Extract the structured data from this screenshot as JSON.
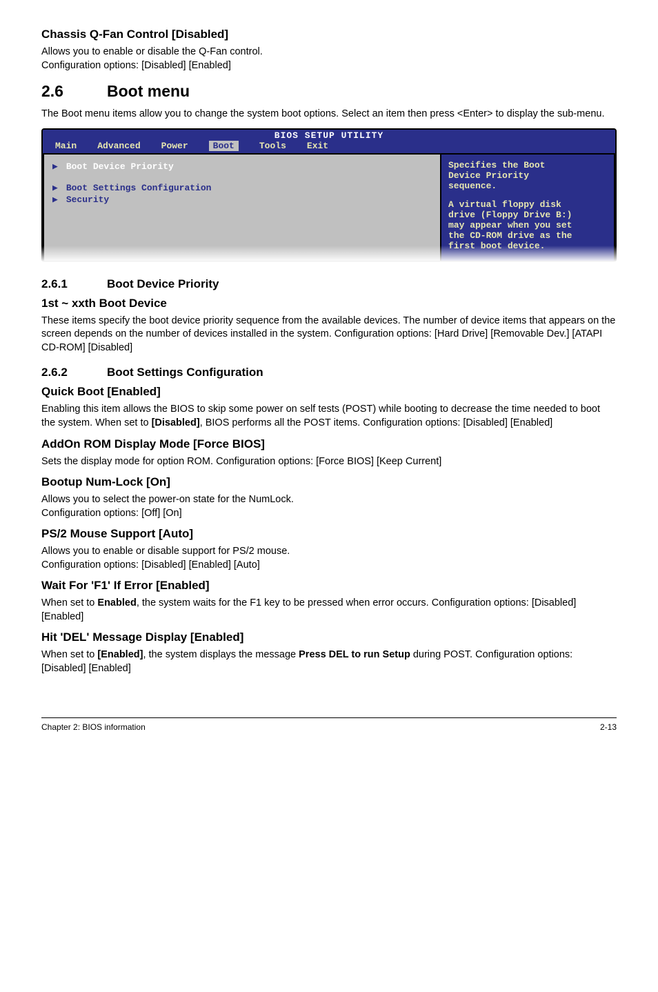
{
  "section_qfan": {
    "heading": "Chassis Q-Fan Control [Disabled]",
    "p1": "Allows you to enable or disable the Q-Fan control.",
    "p2": "Configuration options: [Disabled] [Enabled]"
  },
  "section_2_6": {
    "num": "2.6",
    "title": "Boot menu",
    "p": "The Boot menu items allow you to change the system boot options. Select an item then press <Enter> to display the sub-menu."
  },
  "bios": {
    "title": "BIOS SETUP UTILITY",
    "tabs": {
      "main": "Main",
      "advanced": "Advanced",
      "power": "Power",
      "boot": "Boot",
      "tools": "Tools",
      "exit": "Exit"
    },
    "menu": {
      "boot_device_priority": "Boot Device Priority",
      "boot_settings_config": "Boot Settings Configuration",
      "security": "Security"
    },
    "help": {
      "l1": "Specifies the Boot",
      "l2": "Device Priority",
      "l3": "sequence.",
      "l4": "A virtual floppy disk",
      "l5": "drive (Floppy Drive B:)",
      "l6": "may appear when you set",
      "l7": "the CD-ROM drive as the",
      "l8": "first boot device."
    }
  },
  "section_2_6_1": {
    "num": "2.6.1",
    "title": "Boot Device Priority",
    "sub": "1st ~ xxth Boot Device",
    "p": "These items specify the boot device priority sequence from the available devices. The number of device items that appears on the screen depends on the number of devices installed in the system. Configuration options: [Hard Drive] [Removable Dev.] [ATAPI CD-ROM] [Disabled]"
  },
  "section_2_6_2": {
    "num": "2.6.2",
    "title": "Boot Settings Configuration"
  },
  "quick_boot": {
    "heading": "Quick Boot [Enabled]",
    "p1": "Enabling this item allows the BIOS to skip some power on self tests (POST) while booting to decrease the time needed to boot the system. When set to ",
    "bold": "[Disabled]",
    "p1b": ", BIOS performs all the POST items. Configuration options: [Disabled] [Enabled]"
  },
  "addon_rom": {
    "heading": "AddOn ROM Display Mode [Force BIOS]",
    "p": "Sets the display mode for option ROM. Configuration options: [Force BIOS] [Keep Current]"
  },
  "numlock": {
    "heading": "Bootup Num-Lock [On]",
    "p1": "Allows you to select the power-on state for the NumLock.",
    "p2": "Configuration options: [Off] [On]"
  },
  "ps2": {
    "heading": "PS/2 Mouse Support [Auto]",
    "p1": "Allows you to enable or disable support for PS/2 mouse.",
    "p2": "Configuration options: [Disabled] [Enabled] [Auto]"
  },
  "f1": {
    "heading": "Wait For 'F1' If Error [Enabled]",
    "p1": "When set to ",
    "bold": "Enabled",
    "p1b": ", the system waits for the F1 key to be pressed when error occurs. Configuration options: [Disabled] [Enabled]"
  },
  "del": {
    "heading": "Hit 'DEL' Message Display [Enabled]",
    "p1": "When set to ",
    "bold1": "[Enabled]",
    "p1b": ", the system displays the message ",
    "bold2": "Press DEL to run Setup",
    "p1c": " during POST. Configuration options: [Disabled] [Enabled]"
  },
  "footer": {
    "left": "Chapter 2: BIOS information",
    "right": "2-13"
  }
}
